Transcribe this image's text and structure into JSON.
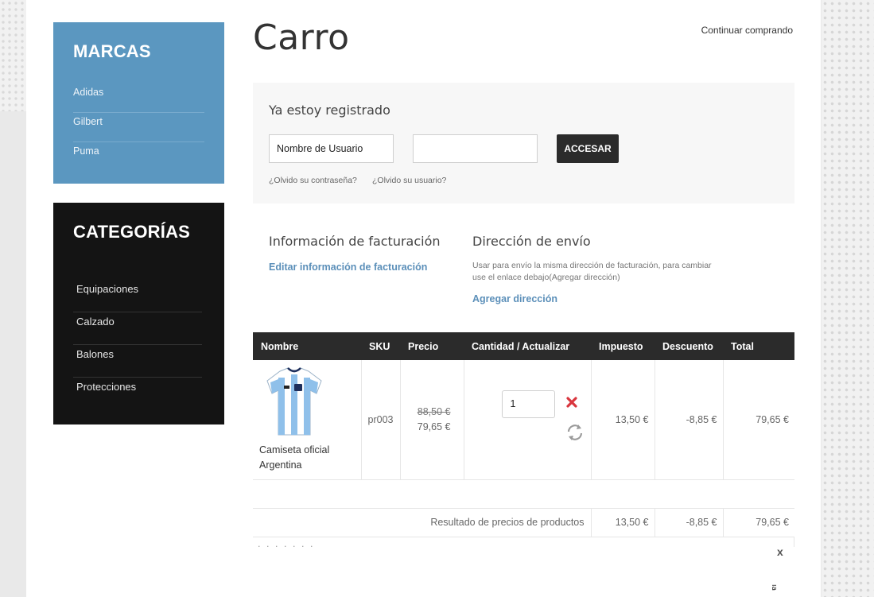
{
  "page": {
    "title": "Carro",
    "continue_link": "Continuar comprando"
  },
  "sidebar": {
    "brands": {
      "title": "MARCAS",
      "items": [
        "Adidas",
        "Gilbert",
        "Puma"
      ]
    },
    "categories": {
      "title": "CATEGORÍAS",
      "items": [
        "Equipaciones",
        "Calzado",
        "Balones",
        "Protecciones"
      ]
    }
  },
  "login": {
    "heading": "Ya estoy registrado",
    "username_value": "Nombre de Usuario",
    "password_value": "",
    "button": "ACCESAR",
    "forgot_password": "¿Olvido su contraseña?",
    "forgot_username": "¿Olvido su usuario?"
  },
  "billing": {
    "title": "Información de facturación",
    "edit_link": "Editar información de facturación"
  },
  "shipping": {
    "title": "Dirección de envío",
    "note": "Usar para envío la misma dirección de facturación, para cambiar use el enlace debajo(Agregar dirección)",
    "add_link": "Agregar dirección"
  },
  "cart": {
    "headers": [
      "Nombre",
      "SKU",
      "Precio",
      "Cantidad / Actualizar",
      "Impuesto",
      "Descuento",
      "Total"
    ],
    "items": [
      {
        "name": "Camiseta oficial Argentina",
        "sku": "pr003",
        "old_price": "88,50 €",
        "price": "79,65 €",
        "quantity": "1",
        "tax": "13,50 €",
        "discount": "-8,85 €",
        "total": "79,65 €"
      }
    ],
    "summary": {
      "label": "Resultado de precios de productos",
      "tax": "13,50 €",
      "discount": "-8,85 €",
      "total": "79,65 €"
    }
  },
  "overlay": {
    "close": "x",
    "side_tab": "ıa"
  },
  "colors": {
    "brands_panel": "#5b97c0",
    "categories_panel": "#141414",
    "link": "#5b8fb9",
    "delete": "#d9363e"
  }
}
